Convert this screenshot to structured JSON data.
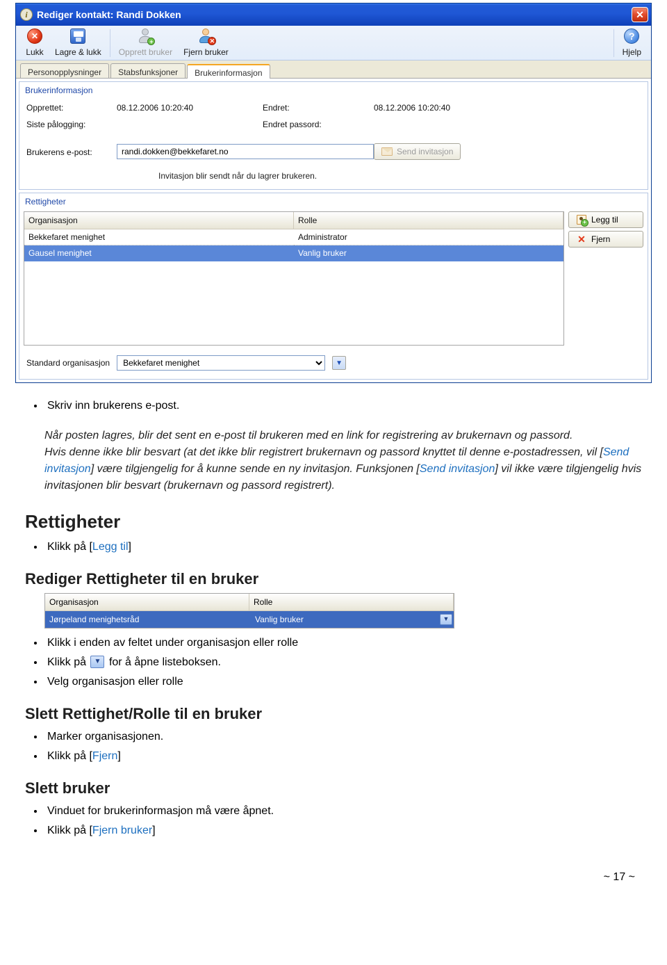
{
  "dialog": {
    "title": "Rediger kontakt: Randi Dokken",
    "toolbar": {
      "close": "Lukk",
      "save": "Lagre & lukk",
      "create_user": "Opprett bruker",
      "remove_user": "Fjern bruker",
      "help": "Hjelp"
    },
    "tabs": [
      "Personopplysninger",
      "Stabsfunksjoner",
      "Brukerinformasjon"
    ],
    "active_tab": 2,
    "group1": {
      "legend": "Brukerinformasjon",
      "created_lbl": "Opprettet:",
      "created_val": "08.12.2006 10:20:40",
      "changed_lbl": "Endret:",
      "changed_val": "08.12.2006 10:20:40",
      "lastlogin_lbl": "Siste pålogging:",
      "changedpw_lbl": "Endret passord:",
      "email_lbl": "Brukerens e-post:",
      "email_val": "randi.dokken@bekkefaret.no",
      "send_inv": "Send invitasjon",
      "note": "Invitasjon blir sendt når du lagrer brukeren."
    },
    "rights": {
      "legend": "Rettigheter",
      "headers": [
        "Organisasjon",
        "Rolle"
      ],
      "rows": [
        {
          "org": "Bekkefaret menighet",
          "role": "Administrator",
          "selected": false
        },
        {
          "org": "Gausel menighet",
          "role": "Vanlig bruker",
          "selected": true
        }
      ],
      "add_btn": "Legg til",
      "del_btn": "Fjern",
      "std_org_lbl": "Standard organisasjon",
      "std_org_val": "Bekkefaret menighet"
    }
  },
  "doc": {
    "bullet1": "Skriv inn brukerens e-post.",
    "note_p1": "Når posten lagres, blir det sent en e-post til brukeren med en link for registrering av brukernavn og passord.",
    "note_p2a": "Hvis denne ikke blir besvart (at det ikke blir registrert brukernavn og passord knyttet til denne e-postadressen, vil [",
    "note_p2_link": "Send invitasjon",
    "note_p2b": "] være tilgjengelig for å kunne sende en ny invitasjon. Funksjonen [",
    "note_p2_link2": "Send invitasjon",
    "note_p2c": "] vil ikke være tilgjengelig hvis invitasjonen blir besvart (brukernavn og passord registrert).",
    "h_rights": "Rettigheter",
    "b_rights": "Klikk på [",
    "b_rights_link": "Legg til",
    "b_rights2": "]",
    "h_edit": "Rediger Rettigheter til en bruker",
    "smalltbl": {
      "headers": [
        "Organisasjon",
        "Rolle"
      ],
      "row": {
        "org": "Jørpeland menighetsråd",
        "role": "Vanlig bruker"
      }
    },
    "e1": "Klikk i enden av feltet under organisasjon eller rolle",
    "e2a": "Klikk på",
    "e2b": "for å åpne listeboksen.",
    "e3": "Velg organisasjon eller rolle",
    "h_del": "Slett Rettighet/Rolle til en bruker",
    "d1": "Marker organisasjonen.",
    "d2a": "Klikk på [",
    "d2_link": "Fjern",
    "d2b": "]",
    "h_deluser": "Slett bruker",
    "u1": "Vinduet for brukerinformasjon må være åpnet.",
    "u2a": "Klikk på [",
    "u2_link": "Fjern bruker",
    "u2b": "]",
    "page": "~ 17 ~"
  }
}
